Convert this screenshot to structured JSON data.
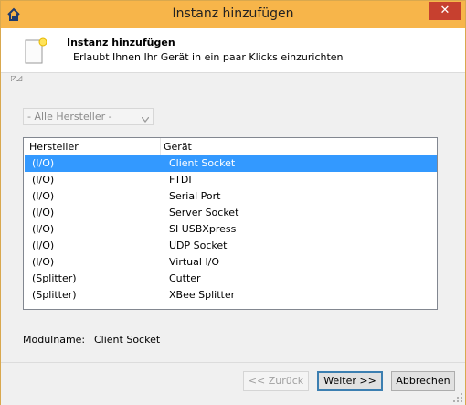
{
  "window": {
    "title": "Instanz hinzufügen",
    "close_glyph": "✕"
  },
  "header": {
    "title": "Instanz hinzufügen",
    "subtitle": "Erlaubt Ihnen Ihr Gerät in ein paar Klicks einzurichten"
  },
  "mini_arrows": "◸◿",
  "filter": {
    "selected": "- Alle Hersteller -"
  },
  "list": {
    "columns": [
      "Hersteller",
      "Gerät"
    ],
    "rows": [
      {
        "vendor": "(I/O)",
        "device": "Client Socket",
        "selected": true
      },
      {
        "vendor": "(I/O)",
        "device": "FTDI"
      },
      {
        "vendor": "(I/O)",
        "device": "Serial Port"
      },
      {
        "vendor": "(I/O)",
        "device": "Server Socket"
      },
      {
        "vendor": "(I/O)",
        "device": "SI USBXpress"
      },
      {
        "vendor": "(I/O)",
        "device": "UDP Socket"
      },
      {
        "vendor": "(I/O)",
        "device": "Virtual I/O"
      },
      {
        "vendor": "(Splitter)",
        "device": "Cutter"
      },
      {
        "vendor": "(Splitter)",
        "device": "XBee Splitter"
      }
    ]
  },
  "module": {
    "label": "Modulname:",
    "value": "Client Socket"
  },
  "buttons": {
    "back": "<< Zurück",
    "next": "Weiter >>",
    "cancel": "Abbrechen"
  },
  "colors": {
    "titlebar": "#f7b54a",
    "close": "#c7402f",
    "selection": "#3399ff"
  }
}
